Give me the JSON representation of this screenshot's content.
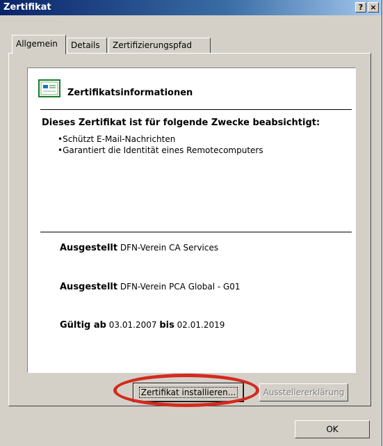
{
  "window": {
    "title": "Zertifikat",
    "help_button": "?",
    "close_button": "×"
  },
  "tabs": [
    {
      "label": "Allgemein"
    },
    {
      "label": "Details"
    },
    {
      "label": "Zertifizierungspfad"
    }
  ],
  "cert_info": {
    "heading": "Zertifikatsinformationen",
    "purpose_title": "Dieses Zertifikat ist für folgende Zwecke beabsichtigt:",
    "purposes": [
      "•Schützt E-Mail-Nachrichten",
      "•Garantiert die Identität eines Remotecomputers"
    ],
    "issued_to_label": "Ausgestellt",
    "issued_to_value": "DFN-Verein CA Services",
    "issued_by_label": "Ausgestellt",
    "issued_by_value": "DFN-Verein PCA Global - G01",
    "valid_from_label": "Gültig ab",
    "valid_from_value": "03.01.2007",
    "valid_to_label": "bis",
    "valid_to_value": "02.01.2019"
  },
  "buttons": {
    "install": "Zertifikat installieren...",
    "issuer_statement": "Ausstellererklärung",
    "ok": "OK"
  },
  "colors": {
    "highlight_ring": "#d42a1e",
    "titlebar": "#0a246a"
  }
}
